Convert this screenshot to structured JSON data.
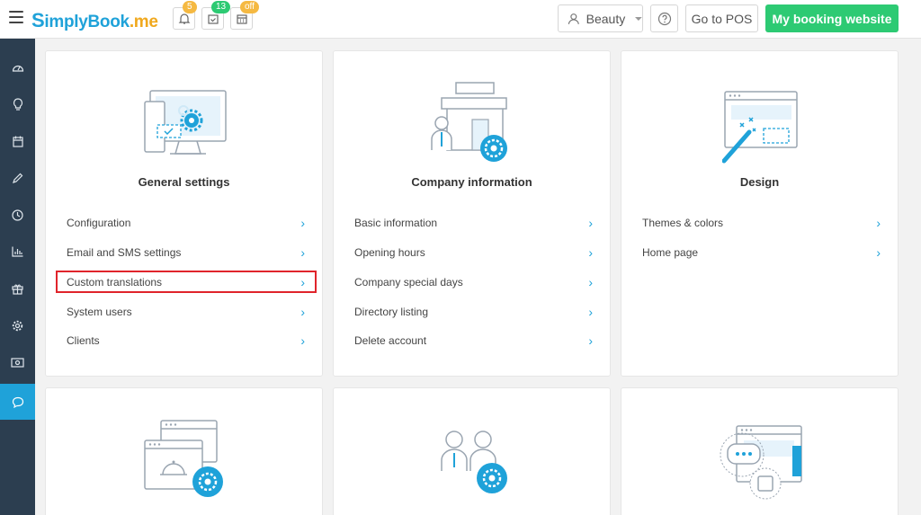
{
  "topbar": {
    "logo_first": "S",
    "logo_mid": "implyBook",
    "logo_ext": ".me",
    "notifications_badge": "5",
    "bookings_badge": "13",
    "calendar_badge": "off",
    "company_select": "Beauty",
    "help_icon": "question-icon",
    "pos_label": "Go to POS",
    "booking_site_label": "My booking website"
  },
  "sidebar": {
    "items": [
      "dashboard-icon",
      "idea-icon",
      "calendar-icon",
      "pencil-icon",
      "clock-icon",
      "chart-icon",
      "gift-icon",
      "gear-icon",
      "money-icon",
      "chat-icon"
    ]
  },
  "cards": [
    {
      "title": "General settings",
      "items": [
        "Configuration",
        "Email and SMS settings",
        "Custom translations",
        "System users",
        "Clients"
      ]
    },
    {
      "title": "Company information",
      "items": [
        "Basic information",
        "Opening hours",
        "Company special days",
        "Directory listing",
        "Delete account"
      ]
    },
    {
      "title": "Design",
      "items": [
        "Themes & colors",
        "Home page"
      ]
    }
  ],
  "colors": {
    "brand_blue": "#1fa2d9",
    "brand_green": "#2dca73",
    "sidebar": "#2c3e50",
    "highlight": "#e0242b"
  }
}
